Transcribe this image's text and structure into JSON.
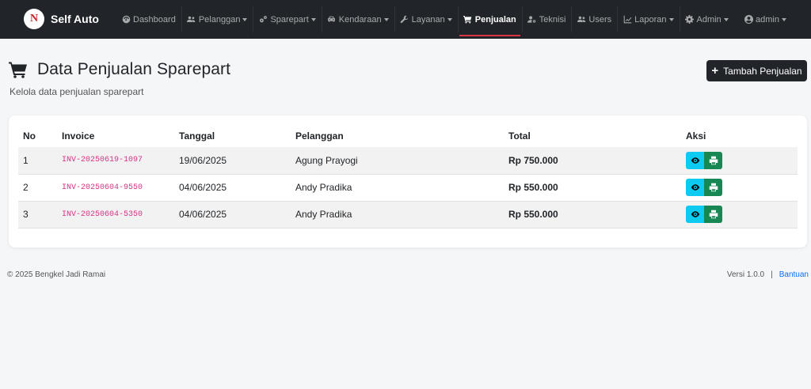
{
  "brand": {
    "name": "Self Auto",
    "logo_letter": "N"
  },
  "nav": {
    "items": [
      {
        "label": "Dashboard",
        "icon": "gauge-icon",
        "dropdown": false,
        "active": false
      },
      {
        "label": "Pelanggan",
        "icon": "users-icon",
        "dropdown": true,
        "active": false
      },
      {
        "label": "Sparepart",
        "icon": "cogs-icon",
        "dropdown": true,
        "active": false
      },
      {
        "label": "Kendaraan",
        "icon": "car-icon",
        "dropdown": true,
        "active": false
      },
      {
        "label": "Layanan",
        "icon": "wrench-icon",
        "dropdown": true,
        "active": false
      },
      {
        "label": "Penjualan",
        "icon": "cart-icon",
        "dropdown": false,
        "active": true
      },
      {
        "label": "Teknisi",
        "icon": "user-gear-icon",
        "dropdown": false,
        "active": false
      },
      {
        "label": "Users",
        "icon": "users-icon",
        "dropdown": false,
        "active": false
      },
      {
        "label": "Laporan",
        "icon": "chart-icon",
        "dropdown": true,
        "active": false
      },
      {
        "label": "Admin",
        "icon": "gear-icon",
        "dropdown": true,
        "active": false
      }
    ],
    "user": {
      "label": "admin",
      "icon": "user-circle-icon"
    }
  },
  "page": {
    "title": "Data Penjualan Sparepart",
    "subtitle": "Kelola data penjualan sparepart",
    "add_button": "Tambah Penjualan"
  },
  "table": {
    "headers": [
      "No",
      "Invoice",
      "Tanggal",
      "Pelanggan",
      "Total",
      "Aksi"
    ],
    "rows": [
      {
        "no": "1",
        "invoice": "INV-20250619-1097",
        "tanggal": "19/06/2025",
        "pelanggan": "Agung Prayogi",
        "total": "Rp 750.000"
      },
      {
        "no": "2",
        "invoice": "INV-20250604-9550",
        "tanggal": "04/06/2025",
        "pelanggan": "Andy Pradika",
        "total": "Rp 550.000"
      },
      {
        "no": "3",
        "invoice": "INV-20250604-5350",
        "tanggal": "04/06/2025",
        "pelanggan": "Andy Pradika",
        "total": "Rp 550.000"
      }
    ]
  },
  "footer": {
    "copyright": "© 2025 Bengkel Jadi Ramai",
    "version": "Versi 1.0.0",
    "separator": "|",
    "help": "Bantuan"
  },
  "colors": {
    "navbar": "#212529",
    "active_indicator": "#dc3545",
    "view_button": "#0dcaf0",
    "print_button": "#198754",
    "invoice_text": "#d63384",
    "link": "#0d6efd"
  }
}
